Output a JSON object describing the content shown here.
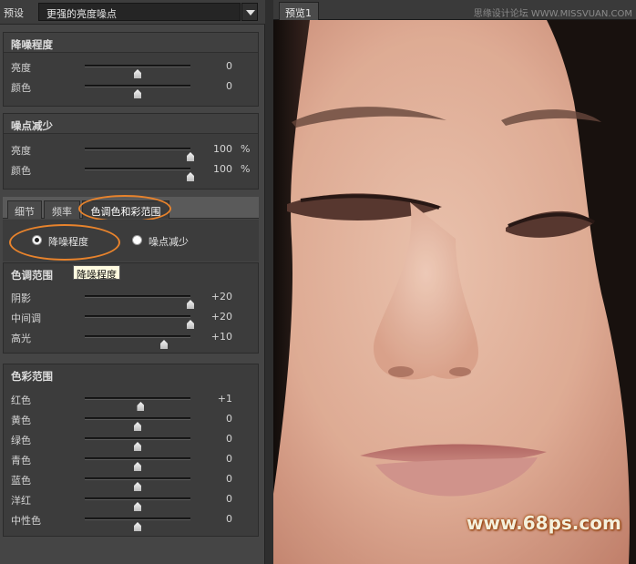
{
  "preset": {
    "label": "预设",
    "value": "更强的亮度噪点"
  },
  "noise_reduction": {
    "title": "降噪程度",
    "rows": [
      {
        "label": "亮度",
        "value": "0",
        "level": 0.5
      },
      {
        "label": "颜色",
        "value": "0",
        "level": 0.5
      }
    ]
  },
  "noise_point": {
    "title": "噪点减少",
    "rows": [
      {
        "label": "亮度",
        "value": "100",
        "unit": "%",
        "level": 1.0
      },
      {
        "label": "颜色",
        "value": "100",
        "unit": "%",
        "level": 1.0
      }
    ]
  },
  "tabs": [
    "细节",
    "频率",
    "色调色和彩范围"
  ],
  "radios": {
    "option1": "降噪程度",
    "option2": "噪点减少"
  },
  "tooltip": "降噪程度",
  "tone_range": {
    "title": "色调范围",
    "rows": [
      {
        "label": "阴影",
        "value": "+20",
        "level": 1.0
      },
      {
        "label": "中间调",
        "value": "+20",
        "level": 1.0
      },
      {
        "label": "高光",
        "value": "+10",
        "level": 0.75
      }
    ]
  },
  "color_range": {
    "title": "色彩范围",
    "rows": [
      {
        "label": "红色",
        "value": "+1",
        "level": 0.53
      },
      {
        "label": "黄色",
        "value": "0",
        "level": 0.5
      },
      {
        "label": "绿色",
        "value": "0",
        "level": 0.5
      },
      {
        "label": "青色",
        "value": "0",
        "level": 0.5
      },
      {
        "label": "蓝色",
        "value": "0",
        "level": 0.5
      },
      {
        "label": "洋红",
        "value": "0",
        "level": 0.5
      },
      {
        "label": "中性色",
        "value": "0",
        "level": 0.5
      }
    ]
  },
  "preview": {
    "tab": "预览1",
    "site_mark": "思缘设计论坛 WWW.MISSVUAN.COM",
    "watermark": "www.68ps.com"
  },
  "colors": {
    "accent_oval": "#e8832c",
    "panel_bg": "#3c3c3c",
    "watermark": "#f4f0dc"
  }
}
